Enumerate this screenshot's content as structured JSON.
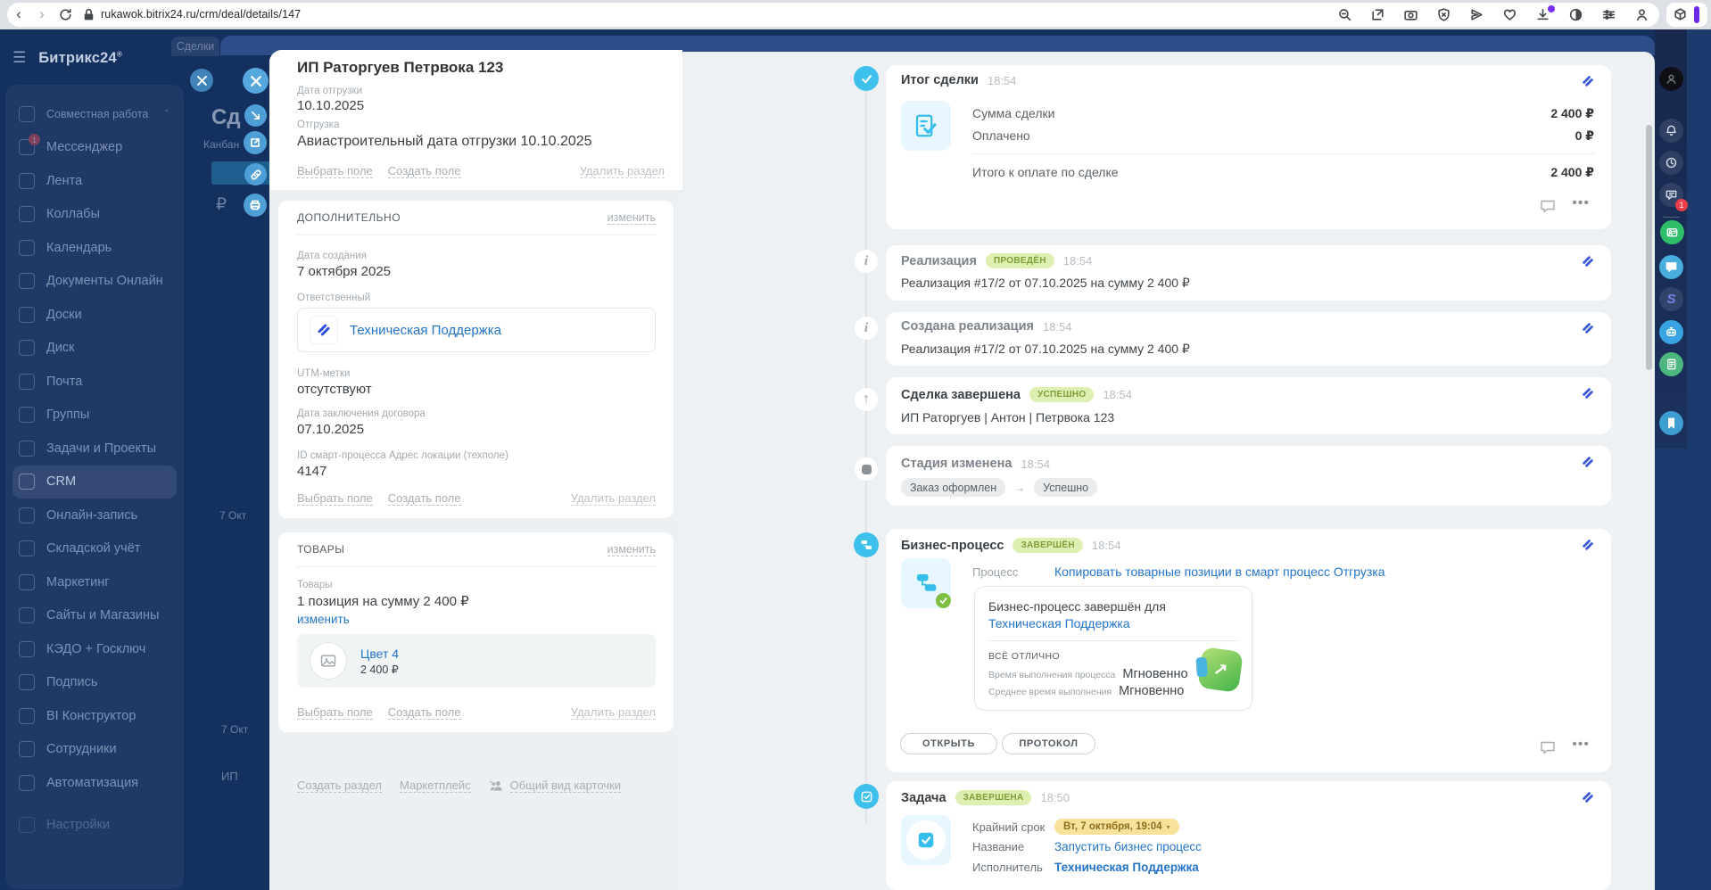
{
  "browser": {
    "url": "rukawok.bitrix24.ru/crm/deal/details/147"
  },
  "app": {
    "logo": "Битрикс24",
    "logo_sup": "®"
  },
  "sidebar": {
    "items": [
      {
        "label": "Совместная работа"
      },
      {
        "label": "Мессенджер",
        "badge": "1"
      },
      {
        "label": "Лента"
      },
      {
        "label": "Коллабы"
      },
      {
        "label": "Календарь"
      },
      {
        "label": "Документы Онлайн"
      },
      {
        "label": "Доски"
      },
      {
        "label": "Диск"
      },
      {
        "label": "Почта"
      },
      {
        "label": "Группы"
      },
      {
        "label": "Задачи и Проекты"
      },
      {
        "label": "CRM"
      },
      {
        "label": "Онлайн-запись"
      },
      {
        "label": "Складской учёт"
      },
      {
        "label": "Маркетинг"
      },
      {
        "label": "Сайты и Магазины"
      },
      {
        "label": "КЭДО + Госключ"
      },
      {
        "label": "Подпись"
      },
      {
        "label": "BI Конструктор"
      },
      {
        "label": "Сотрудники"
      },
      {
        "label": "Автоматизация"
      },
      {
        "label": "Настройки"
      }
    ]
  },
  "backdrop": {
    "deals_tab": "Сделки",
    "kanban_label": "Канбан",
    "title_fragment": "Сд",
    "ruble": "₽",
    "date_fragment": "7 Окт",
    "company_fragment": "ИП"
  },
  "panel": {
    "title": "ИП Раторгуев Петрвока 123",
    "links": {
      "select": "Выбрать поле",
      "create": "Создать поле",
      "remove": "Удалить раздел",
      "edit": "изменить"
    },
    "main": {
      "fields": [
        {
          "label": "Дата отгрузки",
          "value": "10.10.2025"
        },
        {
          "label": "Отгрузка",
          "value": "Авиастроительный дата отгрузки 10.10.2025"
        }
      ]
    },
    "additional": {
      "header": "ДОПОЛНИТЕЛЬНО",
      "fields": [
        {
          "label": "Дата создания",
          "value": "7 октября 2025"
        },
        {
          "label": "Ответственный",
          "value": "Техническая Поддержка"
        },
        {
          "label": "UTM-метки",
          "value": "отсутствуют"
        },
        {
          "label": "Дата заключения договора",
          "value": "07.10.2025"
        },
        {
          "label": "ID смарт-процесса Адрес локации (техполе)",
          "value": "4147"
        }
      ]
    },
    "products": {
      "header": "ТОВАРЫ",
      "label": "Товары",
      "summary": "1 позиция на сумму 2 400 ₽",
      "edit_link": "изменить",
      "item": {
        "name": "Цвет 4",
        "price": "2 400 ₽"
      }
    },
    "footer": {
      "create_section": "Создать раздел",
      "marketplace": "Маркетплейс",
      "card_view": "Общий вид карточки"
    }
  },
  "timeline": {
    "entries": [
      {
        "title": "Итог сделки",
        "time": "18:54",
        "rows": [
          {
            "label": "Сумма сделки",
            "value": "2 400 ₽"
          },
          {
            "label": "Оплачено",
            "value": "0 ₽"
          },
          {
            "label": "Итого к оплате по сделке",
            "value": "2 400 ₽"
          }
        ]
      },
      {
        "title": "Реализация",
        "badge": "ПРОВЕДЁН",
        "time": "18:54",
        "body": "Реализация #17/2 от 07.10.2025 на сумму 2 400 ₽"
      },
      {
        "title": "Создана реализация",
        "time": "18:54",
        "body": "Реализация #17/2 от 07.10.2025 на сумму 2 400 ₽"
      },
      {
        "title": "Сделка завершена",
        "badge": "УСПЕШНО",
        "time": "18:54",
        "body": "ИП Раторгуев | Антон | Петрвока 123"
      },
      {
        "title": "Стадия изменена",
        "time": "18:54",
        "chip_from": "Заказ оформлен",
        "chip_arrow": "→",
        "chip_to": "Успешно"
      },
      {
        "title": "Бизнес-процесс",
        "badge": "ЗАВЕРШЁН",
        "time": "18:54",
        "process_label": "Процесс",
        "process_link": "Копировать товарные позиции в смарт процесс Отгрузка",
        "result_prefix": "Бизнес-процесс завершён для ",
        "result_link": "Техническая Поддержка",
        "stats_header": "ВСЁ ОТЛИЧНО",
        "stats": [
          {
            "label": "Время выполнения процесса",
            "value": "Мгновенно"
          },
          {
            "label": "Среднее время выполнения",
            "value": "Мгновенно"
          }
        ],
        "open_button": "ОТКРЫТЬ",
        "protocol_button": "ПРОТОКОЛ"
      },
      {
        "title": "Задача",
        "badge": "ЗАВЕРШЕНА",
        "time": "18:50",
        "fields": [
          {
            "label": "Крайний срок",
            "value": "Вт, 7 октября, 19:04"
          },
          {
            "label": "Название",
            "value": "Запустить бизнес процесс"
          },
          {
            "label": "Исполнитель",
            "value": "Техническая Поддержка"
          }
        ]
      }
    ]
  },
  "colors": {
    "navy": "#14305f",
    "header_blue": "#2d4d88",
    "marker_cyan": "#3ec0ec",
    "link_blue": "#2374c8",
    "badge_green_bg": "#ddf0b2",
    "badge_green_text": "#7d9e38",
    "chip_yellow_bg": "#f7e29b",
    "chip_yellow_text": "#8d6f1d",
    "badge_red": "#e0454f",
    "ext_purple": "#6d28e8"
  }
}
